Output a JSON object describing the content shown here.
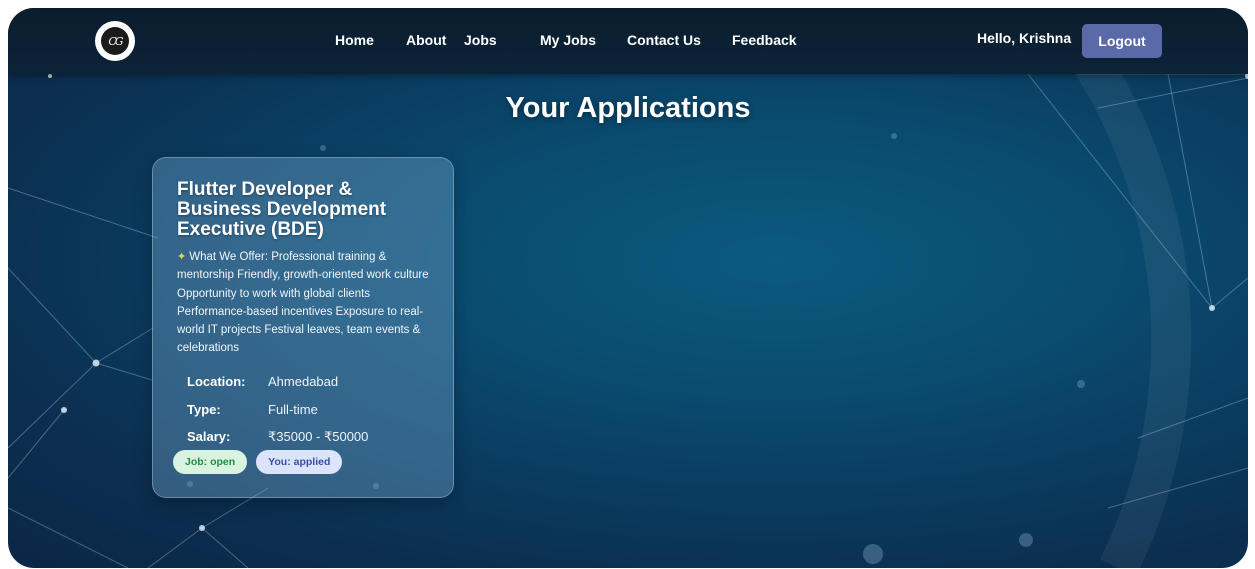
{
  "app": {
    "logo_text": "CG"
  },
  "nav": {
    "items": [
      {
        "label": "Home"
      },
      {
        "label": "About"
      },
      {
        "label": "Jobs"
      },
      {
        "label": "My Jobs"
      },
      {
        "label": "Contact Us"
      },
      {
        "label": "Feedback"
      }
    ]
  },
  "user": {
    "greeting": "Hello, Krishna",
    "logout_label": "Logout"
  },
  "page": {
    "title": "Your Applications"
  },
  "applications": [
    {
      "title": "Flutter Developer & Business Development Executive (BDE)",
      "description_icon": "sparkle-icon",
      "description": "What We Offer: Professional training & mentorship Friendly, growth-oriented work culture Opportunity to work with global clients Performance-based incentives Exposure to real-world IT projects Festival leaves, team events & celebrations",
      "details": [
        {
          "label": "Location:",
          "value": "Ahmedabad"
        },
        {
          "label": "Type:",
          "value": "Full-time"
        },
        {
          "label": "Salary:",
          "value": "₹35000 - ₹50000"
        }
      ],
      "job_status": "Job: open",
      "user_status": "You: applied"
    }
  ],
  "colors": {
    "accent_button": "#5a6aa8",
    "badge_open_bg": "#d8f3df",
    "badge_open_text": "#248a45",
    "badge_applied_bg": "#dbe4fb",
    "badge_applied_text": "#3750a8"
  }
}
